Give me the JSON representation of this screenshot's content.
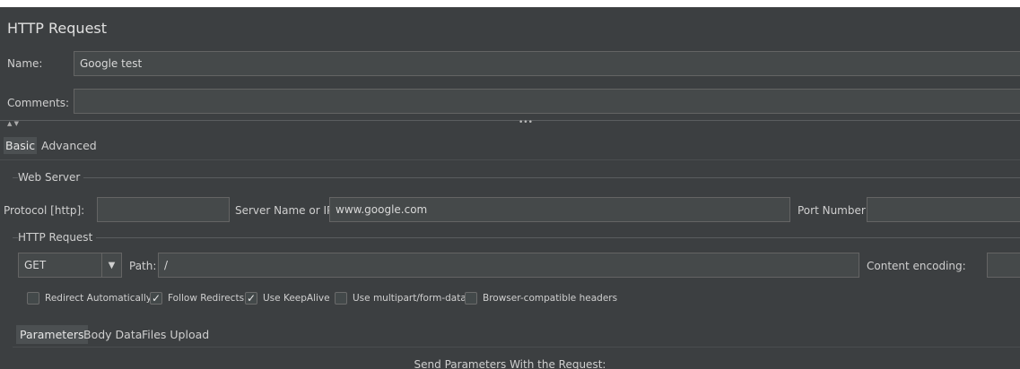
{
  "panel": {
    "title": "HTTP Request"
  },
  "fields": {
    "name_label": "Name:",
    "name_value": "Google test",
    "comments_label": "Comments:",
    "comments_value": ""
  },
  "splitter": {
    "arrows": "▲ ▼",
    "handle": "•••"
  },
  "tabs": [
    {
      "label": "Basic",
      "active": true
    },
    {
      "label": "Advanced",
      "active": false
    }
  ],
  "web_server": {
    "group_title": "Web Server",
    "protocol_label": "Protocol [http]:",
    "protocol_value": "",
    "server_label": "Server Name or IP:",
    "server_value": "www.google.com",
    "port_label": "Port Number:",
    "port_value": ""
  },
  "http_request": {
    "group_title": "HTTP Request",
    "method": "GET",
    "method_dropdown_icon": "▼",
    "path_label": "Path:",
    "path_value": "/",
    "encoding_label": "Content encoding:",
    "encoding_value": ""
  },
  "options": [
    {
      "label": "Redirect Automatically",
      "checked": false
    },
    {
      "label": "Follow Redirects",
      "checked": true
    },
    {
      "label": "Use KeepAlive",
      "checked": true
    },
    {
      "label": "Use multipart/form-data",
      "checked": false
    },
    {
      "label": "Browser-compatible headers",
      "checked": false
    }
  ],
  "check_glyph": "✓",
  "subtabs": [
    {
      "label": "Parameters",
      "active": true
    },
    {
      "label": "Body Data",
      "active": false
    },
    {
      "label": "Files Upload",
      "active": false
    }
  ],
  "parameters": {
    "heading": "Send Parameters With the Request:"
  }
}
